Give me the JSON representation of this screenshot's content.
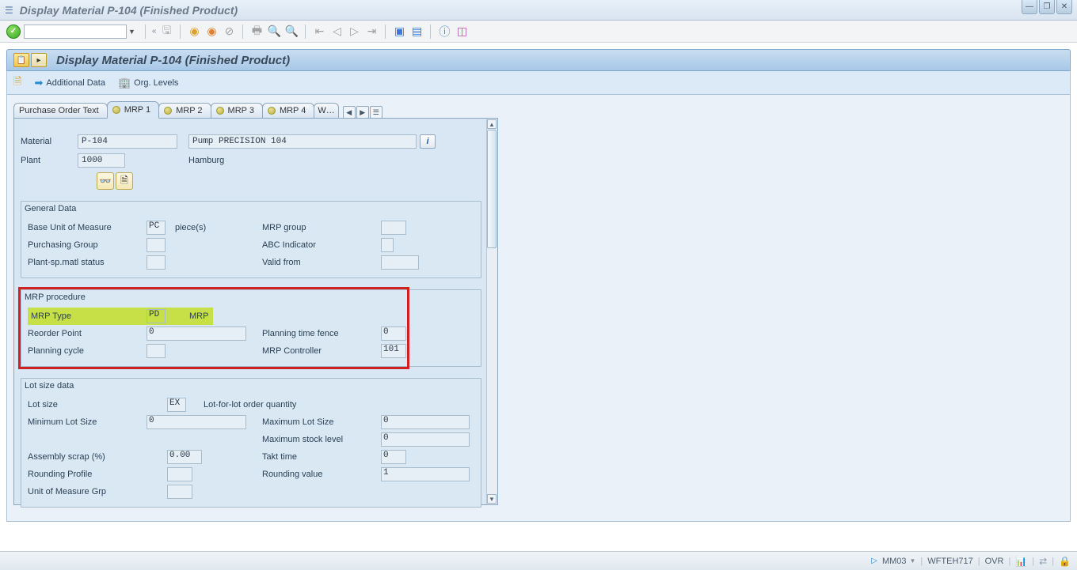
{
  "window": {
    "title": "Display Material P-104 (Finished Product)",
    "panel_title": "Display Material P-104 (Finished Product)"
  },
  "subtoolbar": {
    "additional_data": "Additional Data",
    "org_levels": "Org. Levels"
  },
  "tabs": {
    "po_text": "Purchase Order Text",
    "mrp1": "MRP 1",
    "mrp2": "MRP 2",
    "mrp3": "MRP 3",
    "mrp4": "MRP 4",
    "more": "W…"
  },
  "header": {
    "material_label": "Material",
    "material_value": "P-104",
    "material_desc": "Pump PRECISION 104",
    "plant_label": "Plant",
    "plant_value": "1000",
    "plant_desc": "Hamburg"
  },
  "general": {
    "title": "General Data",
    "base_uom_label": "Base Unit of Measure",
    "base_uom_value": "PC",
    "base_uom_desc": "piece(s)",
    "mrp_group_label": "MRP group",
    "mrp_group_value": "",
    "purch_group_label": "Purchasing Group",
    "purch_group_value": "",
    "abc_label": "ABC Indicator",
    "abc_value": "",
    "plant_status_label": "Plant-sp.matl status",
    "plant_status_value": "",
    "valid_from_label": "Valid from",
    "valid_from_value": ""
  },
  "mrp_proc": {
    "title": "MRP procedure",
    "mrp_type_label": "MRP Type",
    "mrp_type_value": "PD",
    "mrp_type_desc": "MRP",
    "reorder_label": "Reorder Point",
    "reorder_value": "0",
    "ptf_label": "Planning time fence",
    "ptf_value": "0",
    "plan_cycle_label": "Planning cycle",
    "plan_cycle_value": "",
    "mrp_ctrl_label": "MRP Controller",
    "mrp_ctrl_value": "101"
  },
  "lot": {
    "title": "Lot size data",
    "lot_size_label": "Lot size",
    "lot_size_value": "EX",
    "lot_size_desc": "Lot-for-lot order quantity",
    "min_lot_label": "Minimum Lot Size",
    "min_lot_value": "0",
    "max_lot_label": "Maximum Lot Size",
    "max_lot_value": "0",
    "max_stock_label": "Maximum stock level",
    "max_stock_value": "0",
    "asm_scrap_label": "Assembly scrap (%)",
    "asm_scrap_value": "0.00",
    "takt_label": "Takt time",
    "takt_value": "0",
    "round_prof_label": "Rounding Profile",
    "round_prof_value": "",
    "round_val_label": "Rounding value",
    "round_val_value": "1",
    "uom_grp_label": "Unit of Measure Grp",
    "uom_grp_value": ""
  },
  "status": {
    "tcode": "MM03",
    "system": "WFTEH717",
    "mode": "OVR"
  }
}
